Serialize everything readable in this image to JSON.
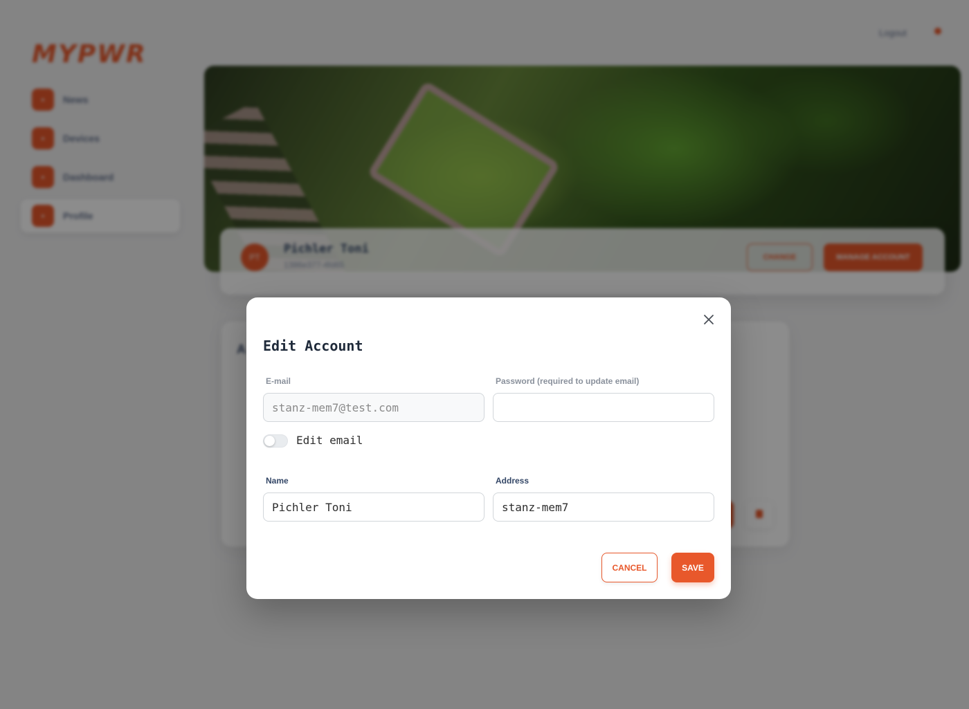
{
  "app": {
    "brand": "MYPWR",
    "logout_label": "Logout",
    "nav_items": [
      {
        "label": "News",
        "icon": "news-icon"
      },
      {
        "label": "Devices",
        "icon": "devices-icon"
      },
      {
        "label": "Dashboard",
        "icon": "dashboard-icon"
      },
      {
        "label": "Profile",
        "icon": "profile-icon",
        "active": true
      }
    ],
    "profile_card": {
      "avatar_initials": "PT",
      "name": "Pichler Toni",
      "subtitle": "1386e377-4fd65",
      "secondary_button": "CHANGE",
      "primary_button": "MANAGE ACCOUNT"
    },
    "account_card": {
      "title": "A"
    }
  },
  "modal": {
    "title": "Edit Account",
    "close_icon": "close-icon",
    "email": {
      "label": "E-mail",
      "value": "stanz-mem7@test.com"
    },
    "password": {
      "label": "Password (required to update email)",
      "value": ""
    },
    "edit_email_toggle": {
      "label": "Edit email",
      "checked": false
    },
    "name": {
      "label": "Name",
      "value": "Pichler Toni"
    },
    "address": {
      "label": "Address",
      "value": "stanz-mem7"
    },
    "cancel_label": "CANCEL",
    "save_label": "SAVE"
  },
  "colors": {
    "accent": "#e8582b",
    "overlay": "rgba(0,0,0,0.45)"
  }
}
